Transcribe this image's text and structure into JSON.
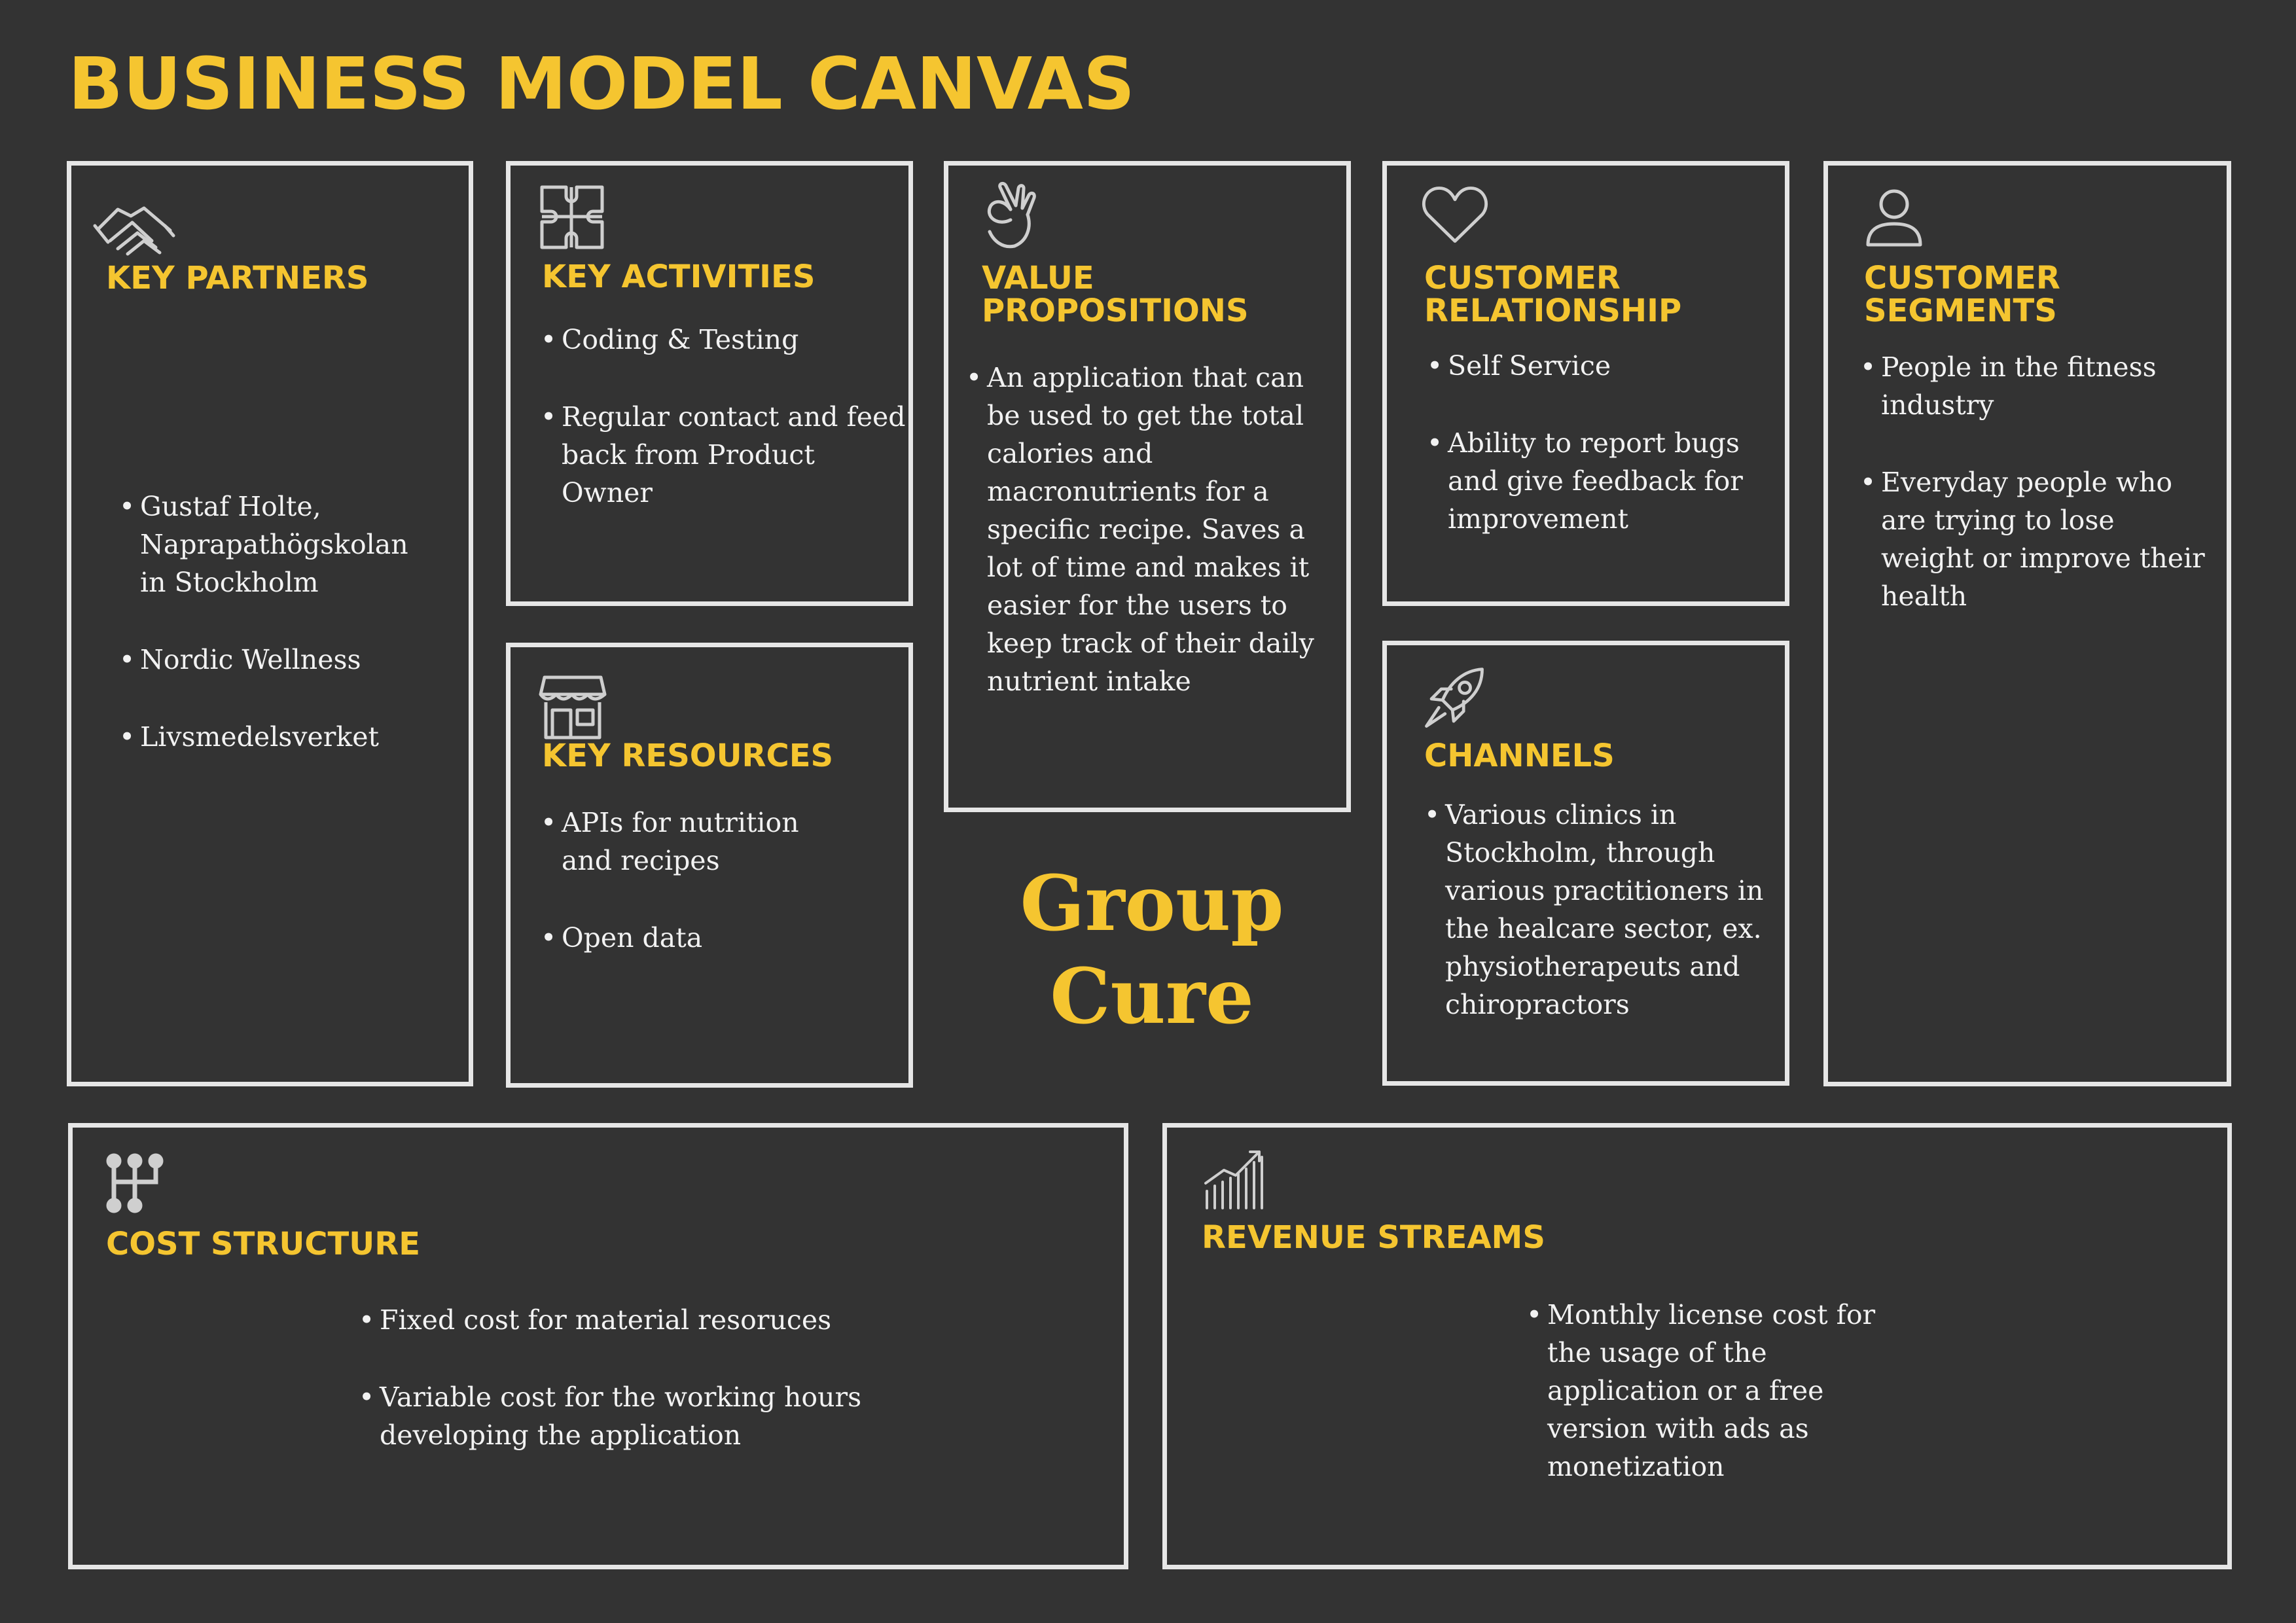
{
  "title": "BUSINESS MODEL CANVAS",
  "brand_line1": "Group",
  "brand_line2": "Cure",
  "colors": {
    "background": "#333333",
    "accent": "#f5c530",
    "border": "#e6e6e6",
    "text": "#f2f2f2"
  },
  "blocks": {
    "key_partners": {
      "icon": "handshake-icon",
      "heading": "KEY PARTNERS",
      "items": [
        "Gustaf Holte, Naprapathögskolan in Stockholm",
        "Nordic Wellness",
        "Livsmedelsverket"
      ]
    },
    "key_activities": {
      "icon": "puzzle-icon",
      "heading": "KEY ACTIVITIES",
      "items": [
        "Coding & Testing",
        "Regular contact and feed back from Product Owner"
      ]
    },
    "key_resources": {
      "icon": "store-icon",
      "heading": "KEY RESOURCES",
      "items": [
        "APIs for nutrition and recipes",
        "Open data"
      ]
    },
    "value_propositions": {
      "icon": "ok-hand-icon",
      "heading": "VALUE PROPOSITIONS",
      "items": [
        "An application that can be used to get the total calories and macronutrients for a specific recipe. Saves a lot of time and makes it easier for the users to keep track of their daily nutrient intake"
      ]
    },
    "customer_relationship": {
      "icon": "heart-icon",
      "heading": "CUSTOMER RELATIONSHIP",
      "items": [
        "Self Service",
        "Ability to report bugs and give feedback for improvement"
      ]
    },
    "channels": {
      "icon": "rocket-icon",
      "heading": "CHANNELS",
      "items": [
        "Various clinics in Stockholm, through various practitioners in the healcare sector, ex. physiotherapeuts and chiropractors"
      ]
    },
    "customer_segments": {
      "icon": "user-icon",
      "heading": "CUSTOMER SEGMENTS",
      "items": [
        "People in the fitness industry",
        "Everyday people who are trying to lose weight or improve their health"
      ]
    },
    "cost_structure": {
      "icon": "hierarchy-icon",
      "heading": "COST STRUCTURE",
      "items": [
        "Fixed cost for material resoruces",
        "Variable cost for the working hours developing the application"
      ]
    },
    "revenue_streams": {
      "icon": "growth-chart-icon",
      "heading": "REVENUE STREAMS",
      "items": [
        "Monthly license cost for the usage of the application or a free version with ads as monetization"
      ]
    }
  }
}
